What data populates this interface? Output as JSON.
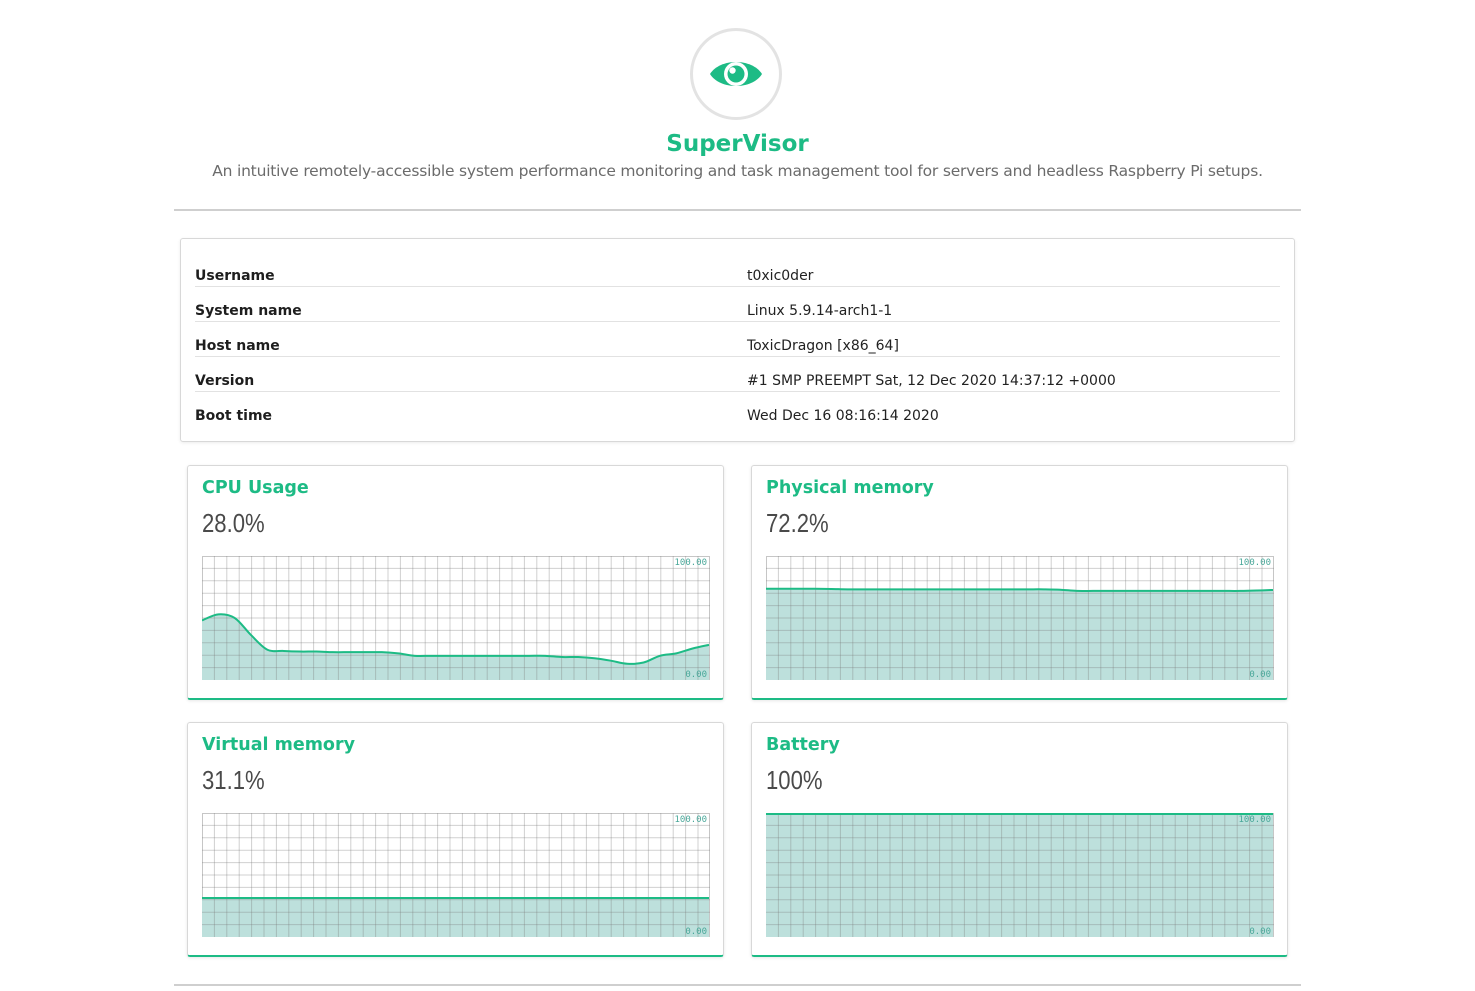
{
  "app": {
    "title": "SuperVisor",
    "subtitle": "An intuitive remotely-accessible system performance monitoring and task management tool for servers and headless Raspberry Pi setups.",
    "logo_icon": "eye-icon",
    "accent_color": "#1dbb85"
  },
  "system_info": [
    {
      "label": "Username",
      "value": "t0xic0der"
    },
    {
      "label": "System name",
      "value": "Linux 5.9.14-arch1-1"
    },
    {
      "label": "Host name",
      "value": "ToxicDragon [x86_64]"
    },
    {
      "label": "Version",
      "value": "#1 SMP PREEMPT Sat, 12 Dec 2020 14:37:12 +0000"
    },
    {
      "label": "Boot time",
      "value": "Wed Dec 16 08:16:14 2020"
    }
  ],
  "stats": [
    {
      "title": "CPU Usage",
      "value": "28.0%",
      "max_label": "100.00",
      "min_label": "0.00"
    },
    {
      "title": "Physical memory",
      "value": "72.2%",
      "max_label": "100.00",
      "min_label": "0.00"
    },
    {
      "title": "Virtual memory",
      "value": "31.1%",
      "max_label": "100.00",
      "min_label": "0.00"
    },
    {
      "title": "Battery",
      "value": "100%",
      "max_label": "100.00",
      "min_label": "0.00"
    }
  ],
  "chart_data": [
    {
      "type": "area",
      "title": "CPU Usage",
      "ylim": [
        0,
        100
      ],
      "grid": true,
      "values": [
        48,
        53,
        50,
        36,
        24,
        23,
        22.5,
        22.5,
        22,
        22,
        22,
        22,
        21,
        19,
        19,
        19,
        19,
        19,
        19,
        19,
        19,
        19,
        18,
        18,
        17,
        15,
        12.5,
        13.5,
        19,
        21,
        25,
        28
      ]
    },
    {
      "type": "area",
      "title": "Physical memory",
      "ylim": [
        0,
        100
      ],
      "grid": true,
      "values": [
        74,
        74,
        74,
        74,
        73.8,
        73.5,
        73.5,
        73.5,
        73.5,
        73.5,
        73.5,
        73.5,
        73.5,
        73.5,
        73.5,
        73.5,
        73.5,
        73.5,
        73.2,
        72.2,
        72.2,
        72.2,
        72.2,
        72.2,
        72.2,
        72.2,
        72.2,
        72.2,
        72.2,
        72.2,
        72.5,
        73
      ]
    },
    {
      "type": "area",
      "title": "Virtual memory",
      "ylim": [
        0,
        100
      ],
      "grid": true,
      "values": [
        31.1,
        31.1,
        31.1,
        31.1,
        31.1,
        31.1,
        31.1,
        31.1,
        31.1,
        31.1,
        31.1,
        31.1,
        31.1,
        31.1,
        31.1,
        31.1,
        31.1,
        31.1,
        31.1,
        31.1,
        31.1,
        31.1,
        31.1,
        31.1,
        31.1,
        31.1,
        31.1,
        31.1,
        31.1,
        31.1,
        31.1,
        31.1
      ]
    },
    {
      "type": "area",
      "title": "Battery",
      "ylim": [
        0,
        100
      ],
      "grid": true,
      "values": [
        100,
        100,
        100,
        100,
        100,
        100,
        100,
        100,
        100,
        100,
        100,
        100,
        100,
        100,
        100,
        100,
        100,
        100,
        100,
        100,
        100,
        100,
        100,
        100,
        100,
        100,
        100,
        100,
        100,
        100,
        100,
        100
      ]
    }
  ]
}
